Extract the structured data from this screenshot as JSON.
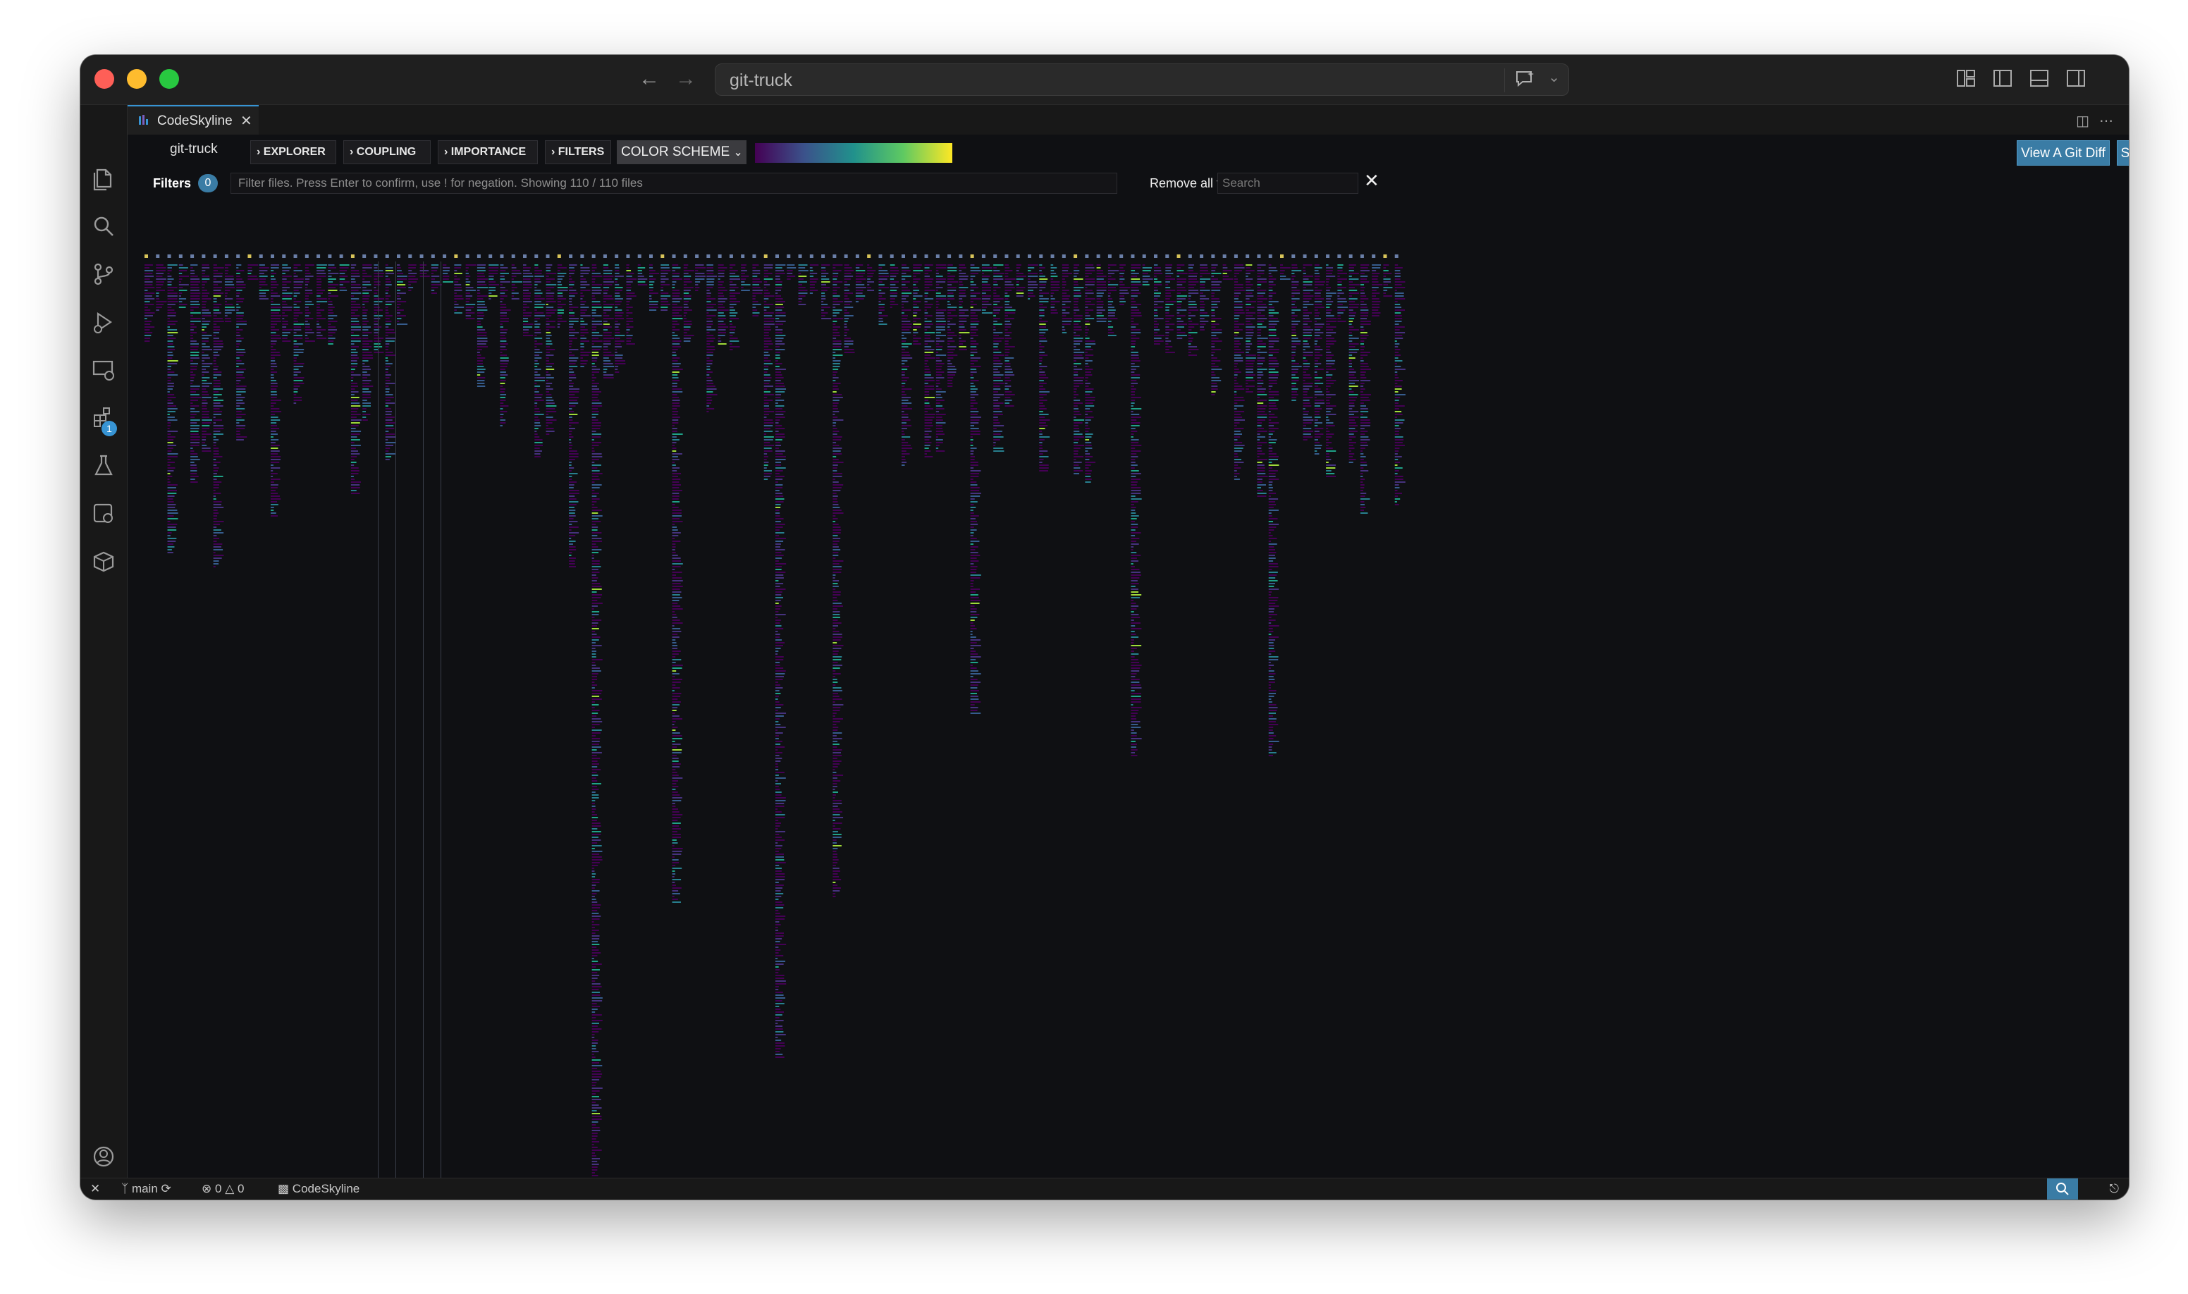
{
  "window": {
    "command_center": "git-truck"
  },
  "tab": {
    "label": "CodeSkyline"
  },
  "toolbar": {
    "repo_name": "git-truck",
    "buttons": [
      "EXPLORER",
      "COUPLING",
      "IMPORTANCE",
      "FILTERS"
    ],
    "color_scheme": "COLOR SCHEME",
    "view_git_diff": "View A Git Diff",
    "settings": "Settings"
  },
  "filter_bar": {
    "filters_label": "Filters",
    "filters_count": "0",
    "placeholder": "Filter files. Press Enter to confirm, use ! for negation. Showing 110 / 110 files",
    "remove_all": "Remove all filters",
    "search_placeholder": "Search"
  },
  "activity": {
    "extensions_badge": "1"
  },
  "status_bar": {
    "branch": "main",
    "errors": "0",
    "warnings": "0",
    "extension": "CodeSkyline"
  },
  "colors": {
    "accent": "#3794d4",
    "button_blue": "#3a7ca5",
    "gradient": [
      "#440154",
      "#3b528b",
      "#21918c",
      "#5ec962",
      "#fde725"
    ]
  }
}
